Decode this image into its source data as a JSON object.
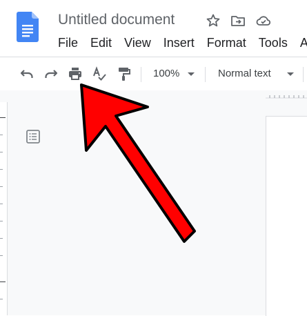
{
  "app": {
    "title": "Untitled document"
  },
  "title_icons": [
    "star-icon",
    "move-to-folder-icon",
    "cloud-saved-icon"
  ],
  "menu": {
    "items": [
      "File",
      "Edit",
      "View",
      "Insert",
      "Format",
      "Tools",
      "A"
    ]
  },
  "toolbar": {
    "icons": [
      "undo-icon",
      "redo-icon",
      "print-icon",
      "spellcheck-icon",
      "paint-format-icon"
    ],
    "zoom": "100%",
    "style": "Normal text"
  },
  "annotation": {
    "arrow_color": "#ff0000",
    "target": "print-icon"
  },
  "colors": {
    "brand_blue": "#4285f4",
    "canvas_bg": "#f8f9fa"
  }
}
